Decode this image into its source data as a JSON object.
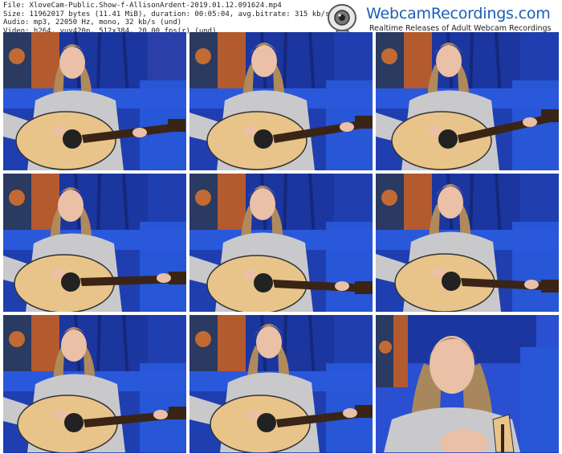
{
  "file_info": {
    "line1": "File: XloveCam-Public.Show-f-AllisonArdent-2019.01.12.091624.mp4",
    "line2": "Size: 11962017 bytes (11.41 MiB), duration: 00:05:04, avg.bitrate: 315 kb/s",
    "line3": "Audio: mp3, 22050 Hz, mono, 32 kb/s (und)",
    "line4": "Video: h264, yuv420p, 512x384, 20.00 fps(r) (und)"
  },
  "logo": {
    "title": "WebcamRecordings.com",
    "subtitle": "Realtime Releases of Adult Webcam Recordings",
    "icon": "webcam-icon",
    "brand_color": "#1a5fb4"
  },
  "thumbnails": [
    {
      "scene": "guitar-playing",
      "icon": "performer-guitar"
    },
    {
      "scene": "guitar-playing",
      "icon": "performer-guitar"
    },
    {
      "scene": "guitar-playing",
      "icon": "performer-guitar"
    },
    {
      "scene": "guitar-playing",
      "icon": "performer-guitar"
    },
    {
      "scene": "guitar-playing",
      "icon": "performer-guitar"
    },
    {
      "scene": "guitar-playing",
      "icon": "performer-guitar"
    },
    {
      "scene": "guitar-playing",
      "icon": "performer-guitar"
    },
    {
      "scene": "guitar-playing",
      "icon": "performer-guitar"
    },
    {
      "scene": "close-up",
      "icon": "performer-closeup"
    }
  ],
  "colors": {
    "curtain": "#1e3aa8",
    "wall": "#b5562c",
    "sofa": "#2a55d8",
    "sweater": "#c9c9cc",
    "guitar_body": "#e8c48a",
    "hair": "#b08a5a",
    "skin": "#eac0a6"
  }
}
